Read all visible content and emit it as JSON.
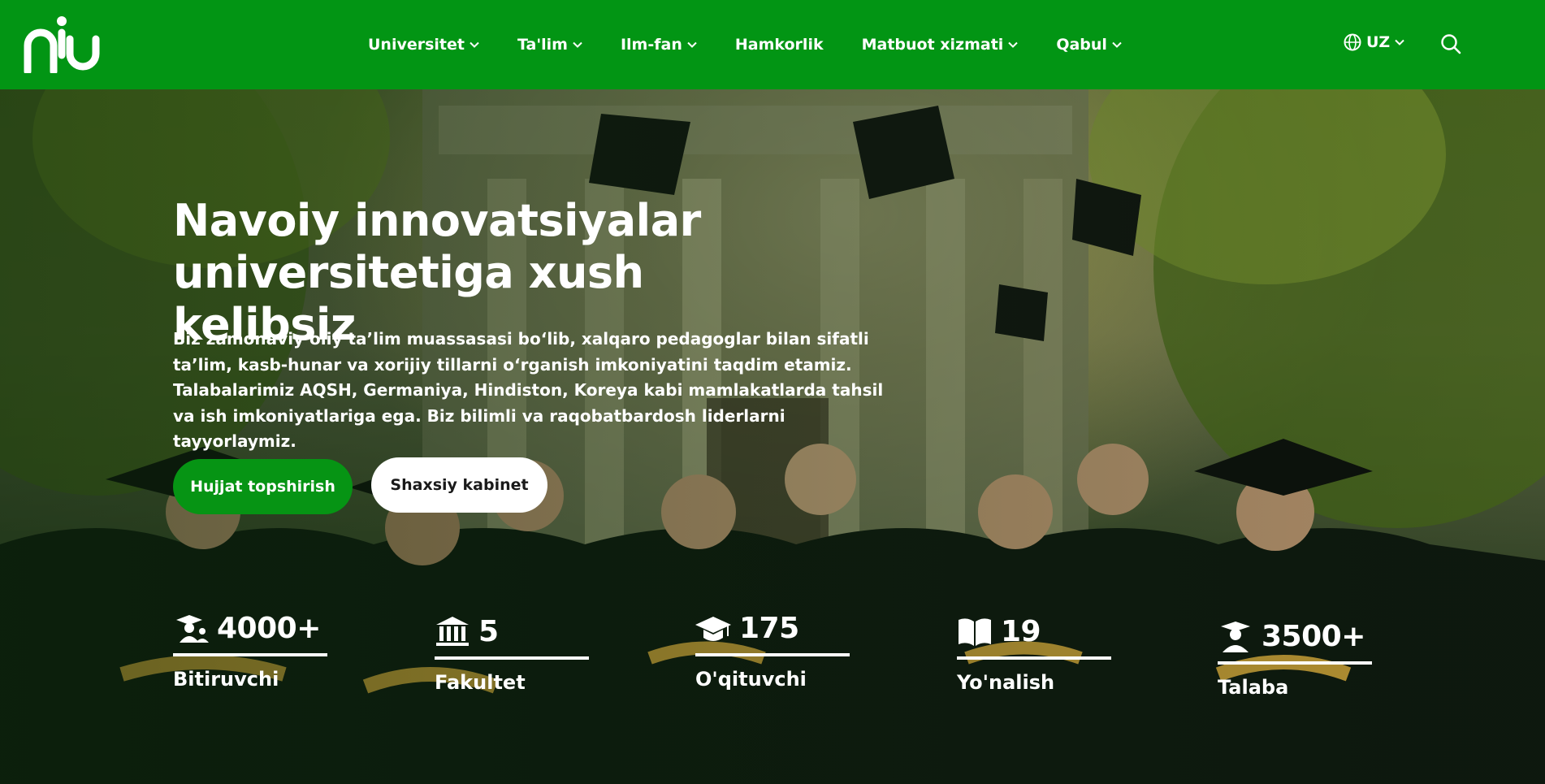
{
  "header": {
    "logo": "niu-logo",
    "nav": [
      {
        "label": "Universitet",
        "has_dropdown": true
      },
      {
        "label": "Ta'lim",
        "has_dropdown": true
      },
      {
        "label": "Ilm-fan",
        "has_dropdown": true
      },
      {
        "label": "Hamkorlik",
        "has_dropdown": false
      },
      {
        "label": "Matbuot xizmati",
        "has_dropdown": true
      },
      {
        "label": "Qabul",
        "has_dropdown": true
      }
    ],
    "language": "UZ",
    "icons": {
      "language": "globe-icon",
      "search": "search-icon",
      "dropdown": "chevron-down-icon"
    }
  },
  "hero": {
    "title_line1": "Navoiy innovatsiyalar",
    "title_line2": "universitetiga xush kelibsiz",
    "description": "Biz zamonaviy oliy ta’lim muassasasi bo‘lib, xalqaro pedagoglar bilan sifatli ta’lim, kasb-hunar va xorijiy tillarni o‘rganish imkoniyatini taqdim etamiz. Talabalarimiz AQSH, Germaniya, Hindiston, Koreya kabi mamlakatlarda tahsil va ish imkoniyatlariga ega. Biz bilimli va raqobatbardosh liderlarni tayyorlaymiz.",
    "primary_button": "Hujjat topshirish",
    "secondary_button": "Shaxsiy kabinet"
  },
  "stats": [
    {
      "value": "4000+",
      "label": "Bitiruvchi",
      "icon": "graduate-group-icon"
    },
    {
      "value": "5",
      "label": "Fakultet",
      "icon": "institution-icon"
    },
    {
      "value": "175",
      "label": "O'qituvchi",
      "icon": "graduation-cap-icon"
    },
    {
      "value": "19",
      "label": "Yo'nalish",
      "icon": "open-book-icon"
    },
    {
      "value": "3500+",
      "label": "Talaba",
      "icon": "student-icon"
    }
  ],
  "colors": {
    "brand_green": "#029514",
    "button_green": "#069414",
    "white": "#ffffff"
  }
}
